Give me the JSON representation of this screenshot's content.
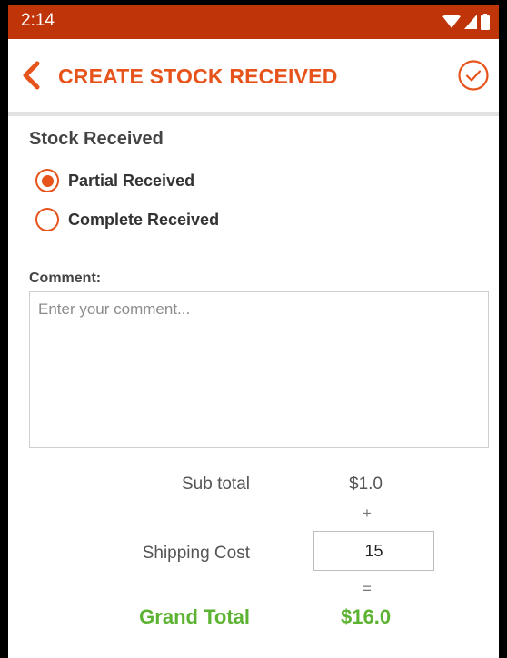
{
  "status_bar": {
    "time": "2:14",
    "icons": [
      "wifi-icon",
      "signal-icon",
      "battery-icon"
    ]
  },
  "toolbar": {
    "title": "CREATE STOCK RECEIVED",
    "back_icon": "chevron-left-icon",
    "confirm_icon": "check-circle-icon"
  },
  "stock_received": {
    "title": "Stock Received",
    "options": [
      {
        "label": "Partial Received",
        "selected": true
      },
      {
        "label": "Complete Received",
        "selected": false
      }
    ]
  },
  "comment": {
    "label": "Comment:",
    "placeholder": "Enter your comment...",
    "value": ""
  },
  "totals": {
    "sub_total_label": "Sub total",
    "sub_total_value": "$1.0",
    "plus": "+",
    "shipping_label": "Shipping Cost",
    "shipping_value": "15",
    "equals": "=",
    "grand_total_label": "Grand Total",
    "grand_total_value": "$16.0"
  },
  "colors": {
    "status_bar": "#c0340a",
    "accent": "#e6541c",
    "grand_total": "#5cb332"
  }
}
